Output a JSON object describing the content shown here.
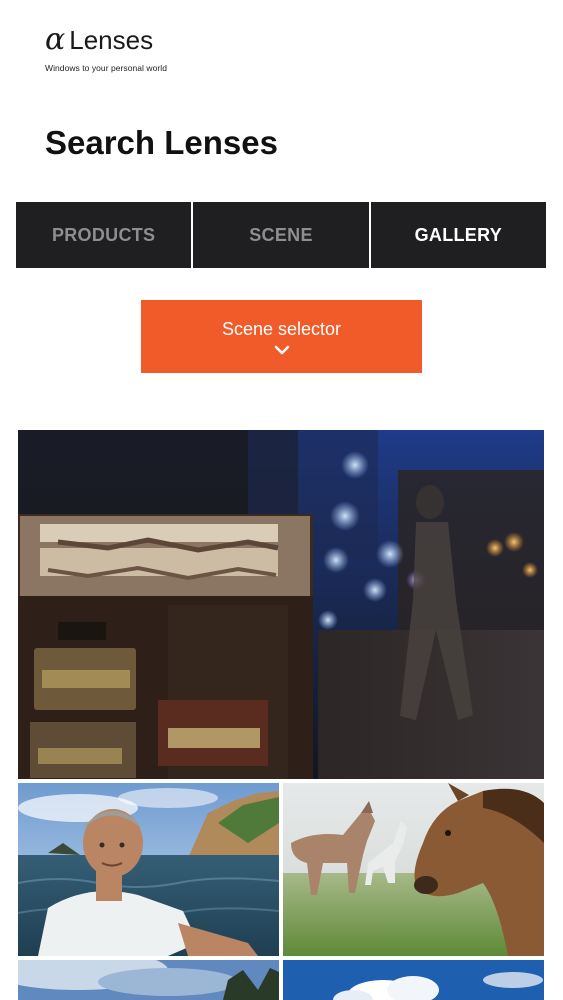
{
  "header": {
    "logo_symbol": "α",
    "brand": "Lenses",
    "tagline": "Windows to your personal world"
  },
  "page_title": "Search Lenses",
  "tabs": [
    {
      "label": "PRODUCTS",
      "active": false
    },
    {
      "label": "SCENE",
      "active": false
    },
    {
      "label": "GALLERY",
      "active": true
    }
  ],
  "scene_selector": {
    "label": "Scene selector",
    "icon": "chevron-down-icon"
  },
  "colors": {
    "accent": "#f15a29",
    "tab_bg": "#1f1e21",
    "tab_inactive_text": "#8e8e8e",
    "tab_active_text": "#ffffff"
  },
  "gallery": {
    "items": [
      {
        "icon": "night-street-photo"
      },
      {
        "icon": "fisherman-photo"
      },
      {
        "icon": "horses-photo"
      },
      {
        "icon": "sky-photo"
      },
      {
        "icon": "sky-clouds-photo"
      }
    ]
  }
}
